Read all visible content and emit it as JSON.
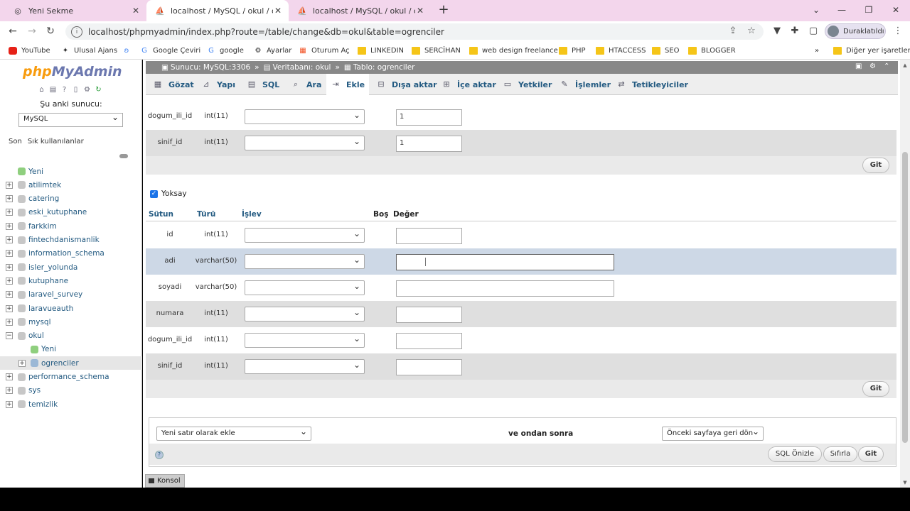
{
  "browser": {
    "tabs": [
      {
        "label": "Yeni Sekme",
        "active": false
      },
      {
        "label": "localhost / MySQL / okul / ogren",
        "active": true
      },
      {
        "label": "localhost / MySQL / okul / ogren",
        "active": false
      }
    ],
    "url": "localhost/phpmyadmin/index.php?route=/table/change&db=okul&table=ogrenciler",
    "profile_label": "Duraklatıldı",
    "bookmarks": [
      "YouTube",
      "Ulusal Ajans",
      "Google Çeviri",
      "google",
      "Ayarlar",
      "Oturum Aç",
      "LINKEDIN",
      "SERCİHAN",
      "web design freelance",
      "PHP",
      "HTACCESS",
      "SEO",
      "BLOGGER"
    ],
    "bookmarks_more": "»",
    "other_bookmarks": "Diğer yer işaretleri"
  },
  "sidebar": {
    "logo_php": "php",
    "logo_admin": "MyAdmin",
    "server_label": "Şu anki sunucu:",
    "server_value": "MySQL",
    "tab_recent": "Son",
    "tab_favorites": "Sık kullanılanlar",
    "tree": [
      {
        "label": "Yeni",
        "level": 0,
        "type": "new"
      },
      {
        "label": "atilimtek",
        "level": 0,
        "type": "db"
      },
      {
        "label": "catering",
        "level": 0,
        "type": "db"
      },
      {
        "label": "eski_kutuphane",
        "level": 0,
        "type": "db"
      },
      {
        "label": "farkkim",
        "level": 0,
        "type": "db"
      },
      {
        "label": "fintechdanismanlik",
        "level": 0,
        "type": "db"
      },
      {
        "label": "information_schema",
        "level": 0,
        "type": "db"
      },
      {
        "label": "isler_yolunda",
        "level": 0,
        "type": "db"
      },
      {
        "label": "kutuphane",
        "level": 0,
        "type": "db"
      },
      {
        "label": "laravel_survey",
        "level": 0,
        "type": "db"
      },
      {
        "label": "laravueauth",
        "level": 0,
        "type": "db"
      },
      {
        "label": "mysql",
        "level": 0,
        "type": "db"
      },
      {
        "label": "okul",
        "level": 0,
        "type": "db-open"
      },
      {
        "label": "Yeni",
        "level": 1,
        "type": "new"
      },
      {
        "label": "ogrenciler",
        "level": 1,
        "type": "table"
      },
      {
        "label": "performance_schema",
        "level": 0,
        "type": "db"
      },
      {
        "label": "sys",
        "level": 0,
        "type": "db"
      },
      {
        "label": "temizlik",
        "level": 0,
        "type": "db"
      }
    ]
  },
  "breadcrumb": {
    "server": "Sunucu: MySQL:3306",
    "sep": "»",
    "database": "Veritabanı: okul",
    "table": "Tablo: ogrenciler"
  },
  "navtabs": [
    "Gözat",
    "Yapı",
    "SQL",
    "Ara",
    "Ekle",
    "Dışa aktar",
    "İçe aktar",
    "Yetkiler",
    "İşlemler",
    "Tetikleyiciler"
  ],
  "navtabs_active": "Ekle",
  "form1": {
    "rows": [
      {
        "column": "dogum_ili_id",
        "type": "int(11)",
        "value": "1"
      },
      {
        "column": "sinif_id",
        "type": "int(11)",
        "value": "1"
      }
    ],
    "go": "Git"
  },
  "ignore_label": "Yoksay",
  "headers": {
    "column": "Sütun",
    "type": "Türü",
    "function": "İşlev",
    "null": "Boş",
    "value": "Değer"
  },
  "form2": {
    "rows": [
      {
        "column": "id",
        "type": "int(11)",
        "value": ""
      },
      {
        "column": "adi",
        "type": "varchar(50)",
        "value": ""
      },
      {
        "column": "soyadi",
        "type": "varchar(50)",
        "value": ""
      },
      {
        "column": "numara",
        "type": "int(11)",
        "value": ""
      },
      {
        "column": "dogum_ili_id",
        "type": "int(11)",
        "value": ""
      },
      {
        "column": "sinif_id",
        "type": "int(11)",
        "value": ""
      }
    ],
    "go": "Git"
  },
  "bottom": {
    "insert_mode": "Yeni satır olarak ekle",
    "then_label": "ve ondan sonra",
    "after_mode": "Önceki sayfaya geri dön",
    "preview": "SQL Önizle",
    "reset": "Sıfırla",
    "go": "Git"
  },
  "console_label": "Konsol"
}
